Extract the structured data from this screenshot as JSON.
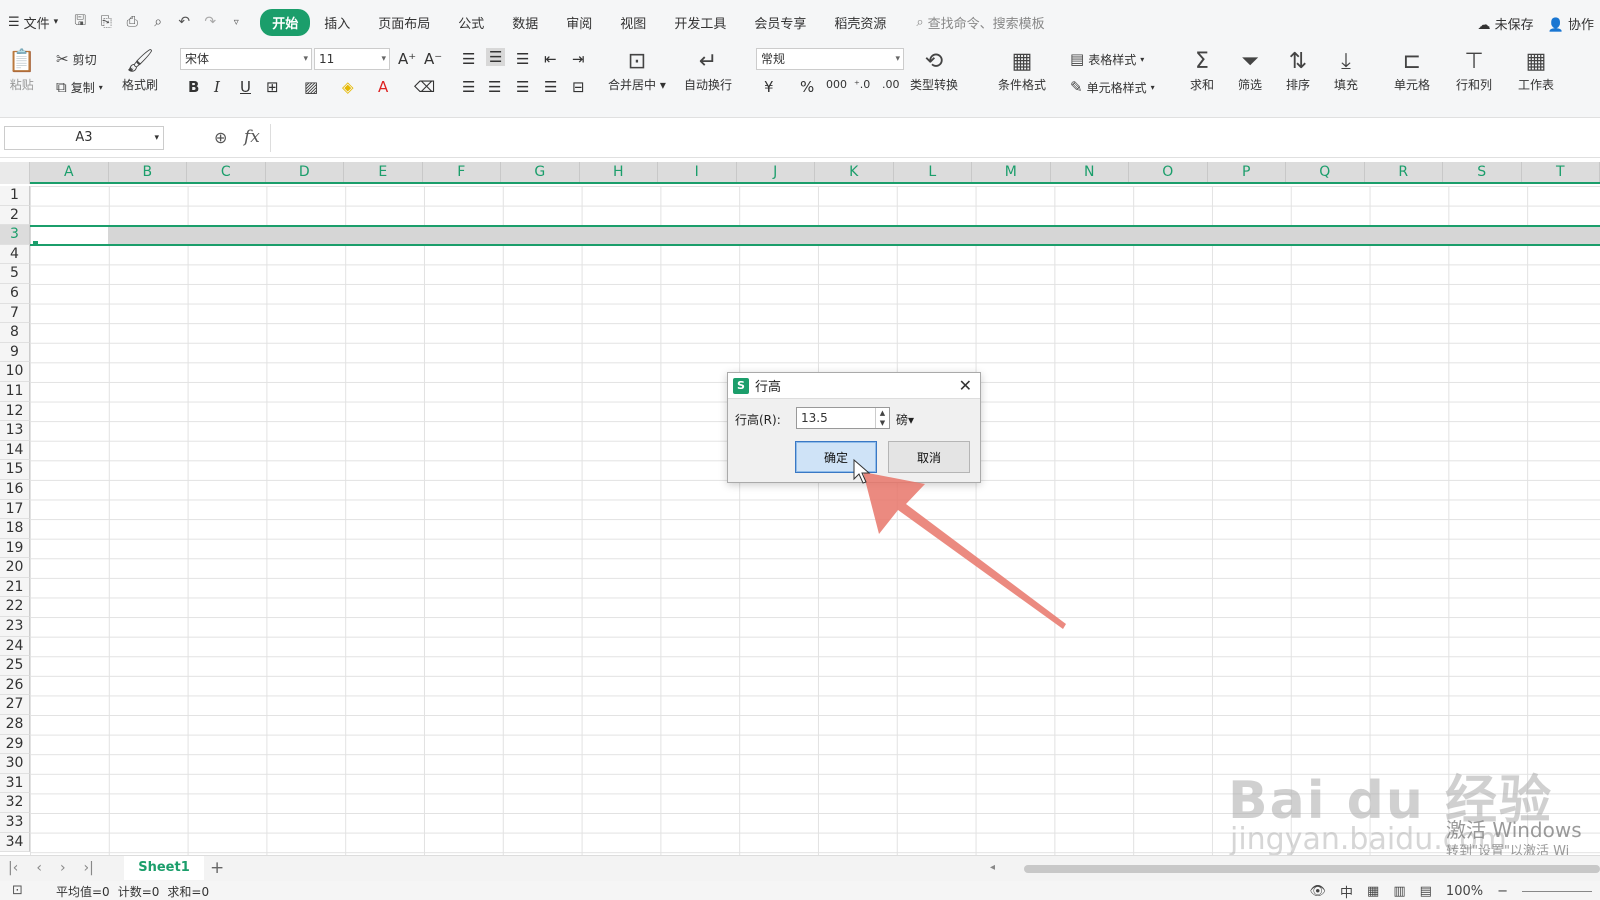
{
  "menu": {
    "file": "文件",
    "tabs": [
      "开始",
      "插入",
      "页面布局",
      "公式",
      "数据",
      "审阅",
      "视图",
      "开发工具",
      "会员专享",
      "稻壳资源"
    ],
    "search": "查找命令、搜索模板",
    "unsaved": "未保存",
    "collab": "协作"
  },
  "ribbon": {
    "paste": "粘贴",
    "cut": "剪切",
    "copy": "复制",
    "format_painter": "格式刷",
    "font_name": "宋体",
    "font_size": "11",
    "merge_center": "合并居中",
    "wrap_text": "自动换行",
    "number_format": "常规",
    "type_convert": "类型转换",
    "conditional_format": "条件格式",
    "table_style": "表格样式",
    "cell_style": "单元格样式",
    "sum": "求和",
    "filter": "筛选",
    "sort": "排序",
    "fill": "填充",
    "cell": "单元格",
    "row_col": "行和列",
    "worksheet": "工作表"
  },
  "formula_bar": {
    "name_box": "A3",
    "fx": "fx"
  },
  "columns": [
    "A",
    "B",
    "C",
    "D",
    "E",
    "F",
    "G",
    "H",
    "I",
    "J",
    "K",
    "L",
    "M",
    "N",
    "O",
    "P",
    "Q",
    "R",
    "S",
    "T"
  ],
  "rows": [
    "1",
    "2",
    "3",
    "4",
    "5",
    "6",
    "7",
    "8",
    "9",
    "10",
    "11",
    "12",
    "13",
    "14",
    "15",
    "16",
    "17",
    "18",
    "19",
    "20",
    "21",
    "22",
    "23",
    "24",
    "25",
    "26",
    "27",
    "28",
    "29",
    "30",
    "31",
    "32",
    "33",
    "34"
  ],
  "selected_row": "3",
  "dialog": {
    "title": "行高",
    "label": "行高(R):",
    "value": "13.5",
    "unit": "磅",
    "ok": "确定",
    "cancel": "取消"
  },
  "sheets": {
    "active": "Sheet1"
  },
  "status": {
    "avg": "平均值=0",
    "count": "计数=0",
    "sum": "求和=0",
    "zoom": "100%"
  },
  "watermark": {
    "baidu": "Bai du 经验",
    "site": "jingyan.baidu.com",
    "win1": "激活 Windows",
    "win2": "转到\"设置\"以激活 Wi"
  },
  "colors": {
    "accent": "#1b9e6b",
    "arrow": "#e8756a"
  }
}
